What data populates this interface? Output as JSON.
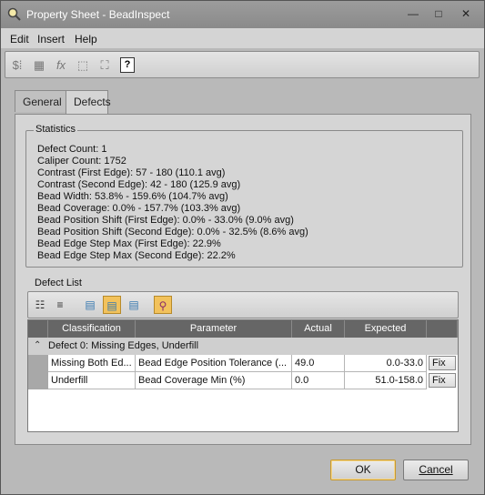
{
  "window": {
    "title": "Property Sheet - BeadInspect",
    "icon": "magnifier-app-icon"
  },
  "title_buttons": {
    "minimize": "—",
    "maximize": "□",
    "close": "✕"
  },
  "menu": [
    "Edit",
    "Insert",
    "Help"
  ],
  "toolbar": {
    "help_label": "?"
  },
  "tabs": [
    {
      "label": "General"
    },
    {
      "label": "Defects",
      "active": true
    }
  ],
  "statistics": {
    "title": "Statistics",
    "lines": [
      "Defect Count: 1",
      "Caliper Count: 1752",
      "Contrast (First Edge): 57 - 180 (110.1 avg)",
      "Contrast (Second Edge): 42 - 180 (125.9 avg)",
      "Bead Width: 53.8% - 159.6% (104.7% avg)",
      "Bead Coverage: 0.0% - 157.7% (103.3% avg)",
      "Bead Position Shift (First Edge): 0.0% - 33.0% (9.0% avg)",
      "Bead Position Shift (Second Edge): 0.0% - 32.5% (8.6% avg)",
      "Bead Edge Step Max (First Edge): 22.9%",
      "Bead Edge Step Max (Second Edge): 22.2%"
    ]
  },
  "defect_list": {
    "title": "Defect List",
    "columns": [
      "Classification",
      "Parameter",
      "Actual",
      "Expected"
    ],
    "group_label": "Defect  0: Missing Edges, Underfill",
    "rows": [
      {
        "classification": "Missing Both Ed...",
        "parameter": "Bead Edge Position Tolerance (...",
        "actual": "49.0",
        "expected": "0.0-33.0",
        "fix": "Fix"
      },
      {
        "classification": "Underfill",
        "parameter": "Bead Coverage Min (%)",
        "actual": "0.0",
        "expected": "51.0-158.0",
        "fix": "Fix"
      }
    ]
  },
  "buttons": {
    "ok": "OK",
    "cancel": "Cancel"
  },
  "colors": {
    "accent": "#f2c25c",
    "header": "#666666"
  }
}
